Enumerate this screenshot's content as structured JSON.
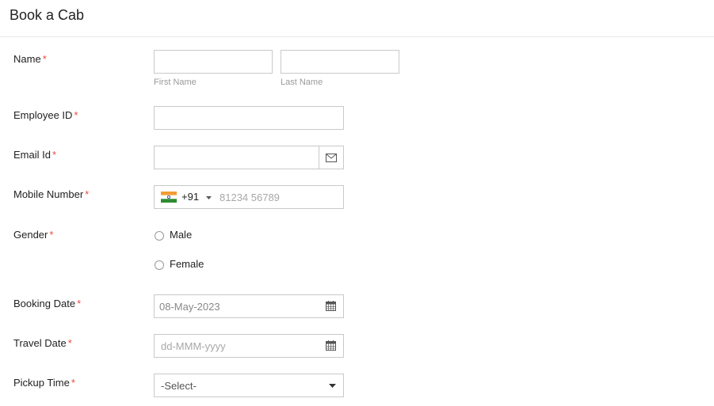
{
  "title": "Book a Cab",
  "required_marker": "*",
  "name": {
    "label": "Name",
    "first_name": {
      "value": "",
      "caption": "First Name"
    },
    "last_name": {
      "value": "",
      "caption": "Last Name"
    }
  },
  "employee_id": {
    "label": "Employee ID",
    "value": ""
  },
  "email": {
    "label": "Email Id",
    "value": "",
    "icon": "envelope-icon"
  },
  "mobile": {
    "label": "Mobile Number",
    "country_flag": "india-flag-icon",
    "country_code": "+91",
    "placeholder": "81234 56789"
  },
  "gender": {
    "label": "Gender",
    "options": [
      "Male",
      "Female"
    ],
    "selected": ""
  },
  "booking_date": {
    "label": "Booking Date",
    "value": "08-May-2023",
    "icon": "calendar-icon"
  },
  "travel_date": {
    "label": "Travel Date",
    "placeholder": "dd-MMM-yyyy",
    "icon": "calendar-icon"
  },
  "pickup_time": {
    "label": "Pickup Time",
    "selected": "-Select-"
  }
}
